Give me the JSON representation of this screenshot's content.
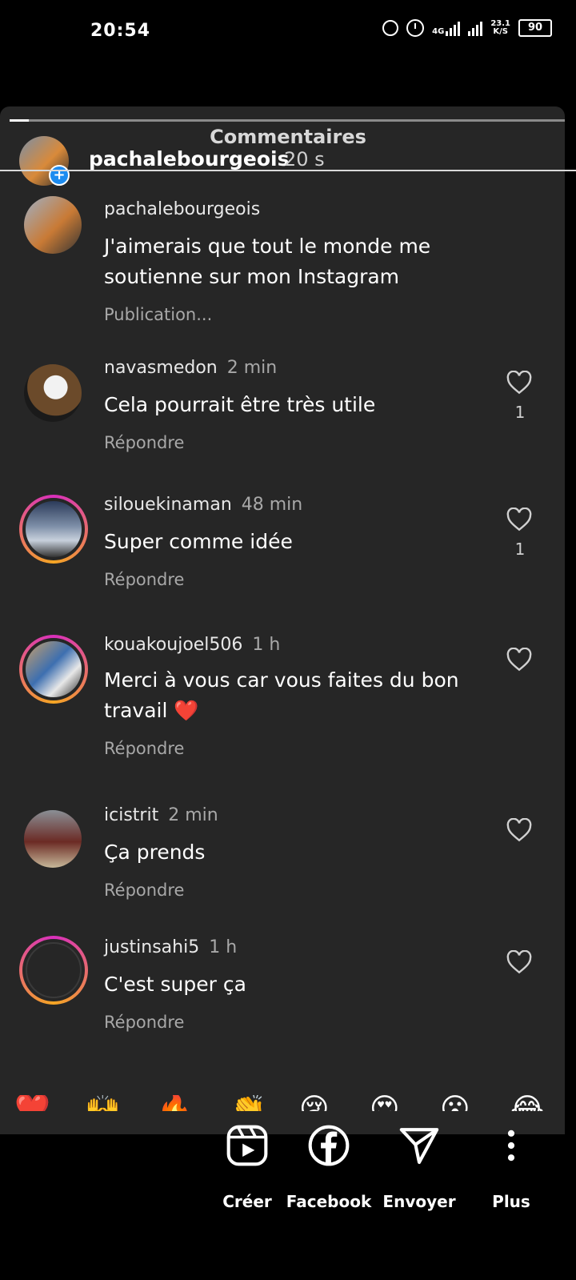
{
  "status": {
    "time": "20:54",
    "network": "4G",
    "speed": "23.1",
    "speed_unit": "K/S",
    "battery": "90"
  },
  "sheet": {
    "title": "Commentaires"
  },
  "story": {
    "username": "pachalebourgeois",
    "time": "20 s"
  },
  "comments": [
    {
      "username": "pachalebourgeois",
      "time": "",
      "text": "J'aimerais que tout le monde me soutienne sur mon Instagram",
      "action": "Publication...",
      "likes": ""
    },
    {
      "username": "navasmedon",
      "time": "2 min",
      "text": "Cela pourrait être très utile",
      "action": "Répondre",
      "likes": "1"
    },
    {
      "username": "silouekinaman",
      "time": "48 min",
      "text": "Super comme idée",
      "action": "Répondre",
      "likes": "1"
    },
    {
      "username": "kouakoujoel506",
      "time": "1 h",
      "text": "Merci à vous car vous faites du bon travail ❤️",
      "action": "Répondre",
      "likes": ""
    },
    {
      "username": "icistrit",
      "time": "2 min",
      "text": "Ça prends",
      "action": "Répondre",
      "likes": ""
    },
    {
      "username": "justinsahi5",
      "time": "1 h",
      "text": "C'est super ça",
      "action": "Répondre",
      "likes": ""
    }
  ],
  "emojis": [
    "❤️",
    "🙌",
    "🔥",
    "👏",
    "😢",
    "😍",
    "😮",
    "😂"
  ],
  "share": [
    {
      "label": "Créer",
      "icon": "reels-icon"
    },
    {
      "label": "Facebook",
      "icon": "facebook-icon"
    },
    {
      "label": "Envoyer",
      "icon": "send-icon"
    },
    {
      "label": "Plus",
      "icon": "more-icon"
    }
  ],
  "colors": {
    "sheet_bg": "#262626",
    "secondary_text": "#a8a8a8",
    "badge": "#1d8cf0"
  }
}
